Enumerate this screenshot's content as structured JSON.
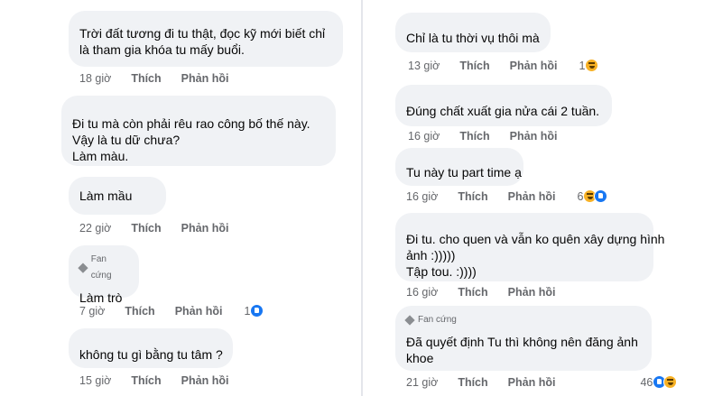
{
  "actions": {
    "like": "Thích",
    "reply": "Phản hồi"
  },
  "left": [
    {
      "lines": [
        "Trời đất tương đi tu thật, đọc kỹ mới biết chỉ",
        "là tham gia khóa tu mấy buổi."
      ],
      "time": "18 giờ"
    },
    {
      "lines": [
        "Đi tu mà còn phải rêu rao công bố thế này.",
        "Vậy là tu dữ chưa?",
        "Làm màu."
      ],
      "time": ""
    },
    {
      "lines": [
        "Làm mầu"
      ],
      "time": "22 giờ"
    },
    {
      "badge": "Fan cứng",
      "lines": [
        "Làm trò"
      ],
      "time": "7 giờ",
      "reactions": {
        "count": "1",
        "icons": [
          "like-icon"
        ]
      }
    },
    {
      "lines": [
        "không tu gì bằng tu tâm ?"
      ],
      "time": "15 giờ"
    }
  ],
  "right": [
    {
      "lines": [
        "Chỉ là tu thời vụ thôi mà"
      ],
      "time": "13 giờ",
      "reactions": {
        "count": "1",
        "icons": [
          "haha-icon"
        ]
      }
    },
    {
      "lines": [
        "Đúng chất xuất gia nửa cái 2 tuần."
      ],
      "time": "16 giờ"
    },
    {
      "lines": [
        "Tu này tu part time ạ"
      ],
      "time": "16 giờ",
      "reactions": {
        "count": "6",
        "icons": [
          "haha-icon",
          "like-icon"
        ]
      }
    },
    {
      "lines": [
        "Đi tu. cho quen và vẫn ko quên xây dựng hình",
        "ảnh :)))))",
        "Tập tou. :))))"
      ],
      "time": "16 giờ"
    },
    {
      "badge": "Fan cứng",
      "lines": [
        "Đã quyết định Tu thì không nên đăng ảnh",
        "khoe"
      ],
      "time": "21 giờ",
      "reactions": {
        "count": "46",
        "icons": [
          "like-icon",
          "haha-icon"
        ]
      }
    }
  ]
}
